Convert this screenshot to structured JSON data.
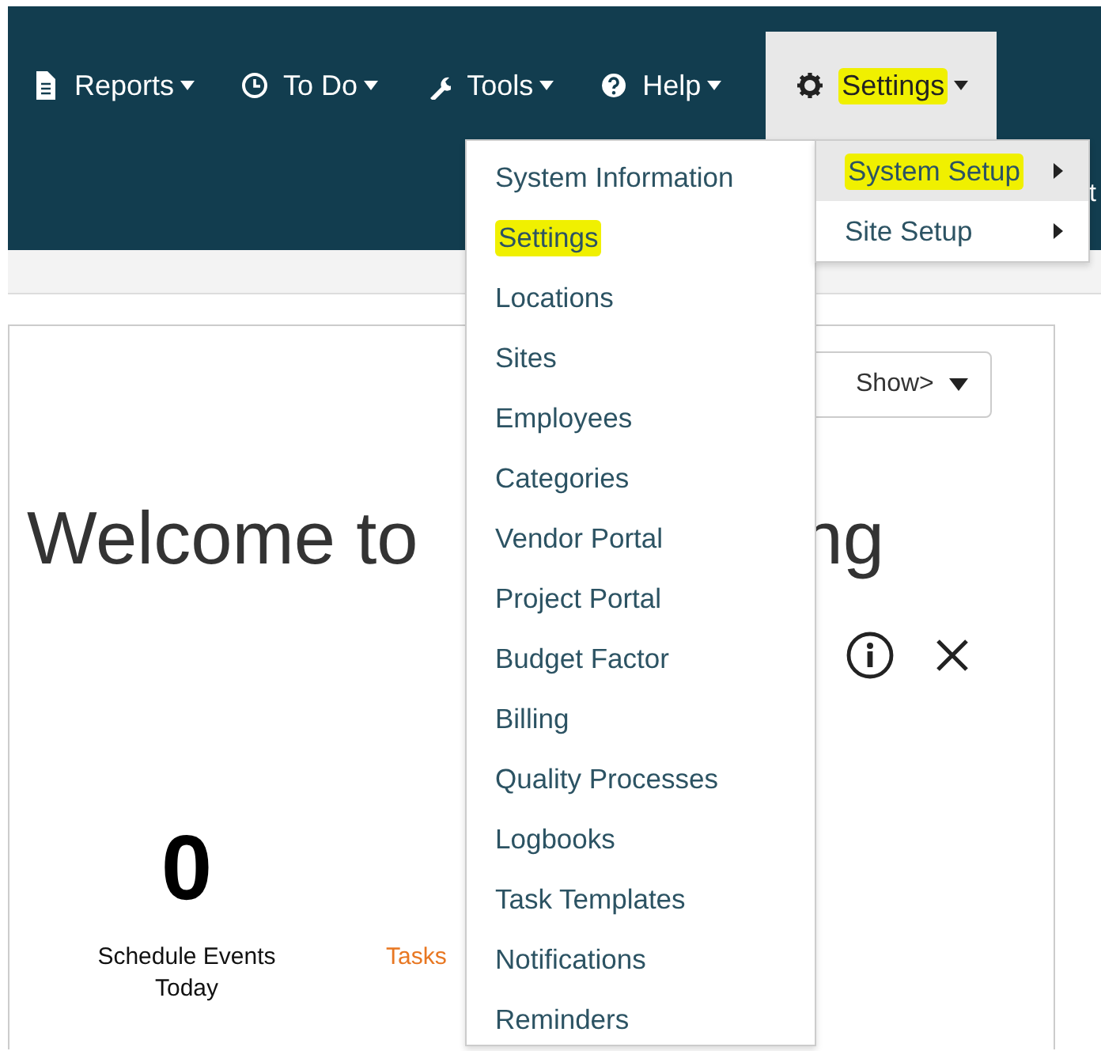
{
  "nav": {
    "items": [
      {
        "label": "Reports",
        "selected": false,
        "highlighted": false
      },
      {
        "label": "To Do",
        "selected": false,
        "highlighted": false
      },
      {
        "label": "Tools",
        "selected": false,
        "highlighted": false
      },
      {
        "label": "Help",
        "selected": false,
        "highlighted": false
      },
      {
        "label": "Settings",
        "selected": true,
        "highlighted": true
      }
    ],
    "edge_fragment": "t"
  },
  "settings_menu": {
    "items": [
      {
        "label": "System Setup",
        "selected": true,
        "highlighted": true
      },
      {
        "label": "Site Setup",
        "selected": false,
        "highlighted": false
      }
    ]
  },
  "system_setup_menu": {
    "items": [
      {
        "label": "System Information",
        "highlighted": false
      },
      {
        "label": "Settings",
        "highlighted": true
      },
      {
        "label": "Locations",
        "highlighted": false
      },
      {
        "label": "Sites",
        "highlighted": false
      },
      {
        "label": "Employees",
        "highlighted": false
      },
      {
        "label": "Categories",
        "highlighted": false
      },
      {
        "label": "Vendor Portal",
        "highlighted": false
      },
      {
        "label": "Project Portal",
        "highlighted": false
      },
      {
        "label": "Budget Factor",
        "highlighted": false
      },
      {
        "label": "Billing",
        "highlighted": false
      },
      {
        "label": "Quality Processes",
        "highlighted": false
      },
      {
        "label": "Logbooks",
        "highlighted": false
      },
      {
        "label": "Task Templates",
        "highlighted": false
      },
      {
        "label": "Notifications",
        "highlighted": false
      },
      {
        "label": "Reminders",
        "highlighted": false
      }
    ]
  },
  "content": {
    "filter": {
      "value": "Show>"
    },
    "heading": "Welcome to",
    "heading_fragment": "ng",
    "stats": [
      {
        "kind": "normal",
        "value": "0",
        "lines": [
          "Schedule Events",
          "Today"
        ]
      },
      {
        "kind": "alert",
        "lines": [
          "Tasks"
        ]
      }
    ]
  }
}
